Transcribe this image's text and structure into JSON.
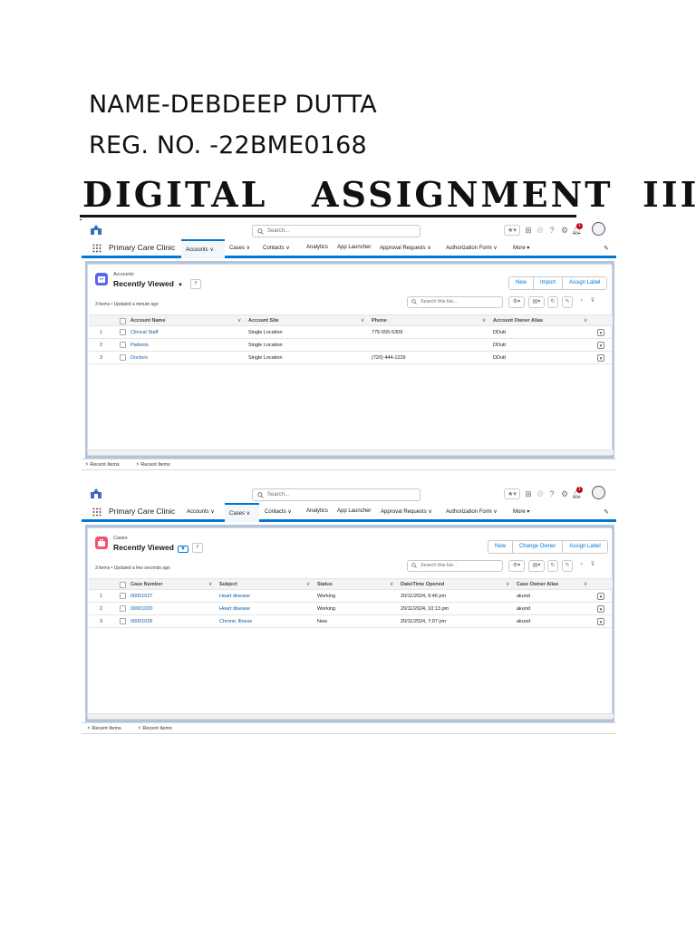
{
  "document": {
    "name_line": "NAME-DEBDEEP DUTTA",
    "reg_line": "REG. NO. -22BME0168",
    "title": "DIGITAL   ASSIGNMENT  III"
  },
  "colors": {
    "brand_blue": "#0176d3",
    "accounts_icon": "#5867e8",
    "cases_icon": "#f2536d",
    "content_bg": "#b0c4df"
  },
  "common": {
    "search_placeholder": "Search...",
    "app_name": "Primary Care Clinic",
    "nav": {
      "accounts": "Accounts",
      "cases": "Cases",
      "contacts": "Contacts",
      "analytics": "Analytics",
      "app_launcher": "App Launcher",
      "approval_requests": "Approval Requests",
      "authorization_form": "Authorization Form",
      "more": "More"
    },
    "list_view": "Recently Viewed",
    "list_search_placeholder": "Search this list...",
    "recent_items": "Recent Items",
    "notification_count": "1"
  },
  "accounts_panel": {
    "object_label": "Accounts",
    "status": "3 items • Updated a minute ago",
    "buttons": {
      "new": "New",
      "import": "Import",
      "assign_label": "Assign Label"
    },
    "columns": [
      "Account Name",
      "Account Site",
      "Phone",
      "Account Owner Alias"
    ],
    "rows": [
      {
        "num": "1",
        "name": "Clinical Staff",
        "site": "Single Location",
        "phone": "775-555-5309",
        "owner": "DDutt"
      },
      {
        "num": "2",
        "name": "Patients",
        "site": "Single Location",
        "phone": "",
        "owner": "DDutt"
      },
      {
        "num": "3",
        "name": "Doctors",
        "site": "Single Location",
        "phone": "(720) 444-1229",
        "owner": "DDutt"
      }
    ]
  },
  "cases_panel": {
    "object_label": "Cases",
    "status": "3 items • Updated a few seconds ago",
    "buttons": {
      "new": "New",
      "change_owner": "Change Owner",
      "assign_label": "Assign Label"
    },
    "columns": [
      "Case Number",
      "Subject",
      "Status",
      "Date/Time Opened",
      "Case Owner Alias"
    ],
    "rows": [
      {
        "num": "1",
        "case_number": "00001027",
        "subject": "Heart disease",
        "status": "Working",
        "opened": "20/11/2024, 9:46 pm",
        "owner": "akund"
      },
      {
        "num": "2",
        "case_number": "00001020",
        "subject": "Heart disease",
        "status": "Working",
        "opened": "20/11/2024, 10:13 pm",
        "owner": "akund"
      },
      {
        "num": "3",
        "case_number": "00001026",
        "subject": "Chronic Illness",
        "status": "New",
        "opened": "20/11/2024, 7:07 pm",
        "owner": "akund"
      }
    ]
  }
}
